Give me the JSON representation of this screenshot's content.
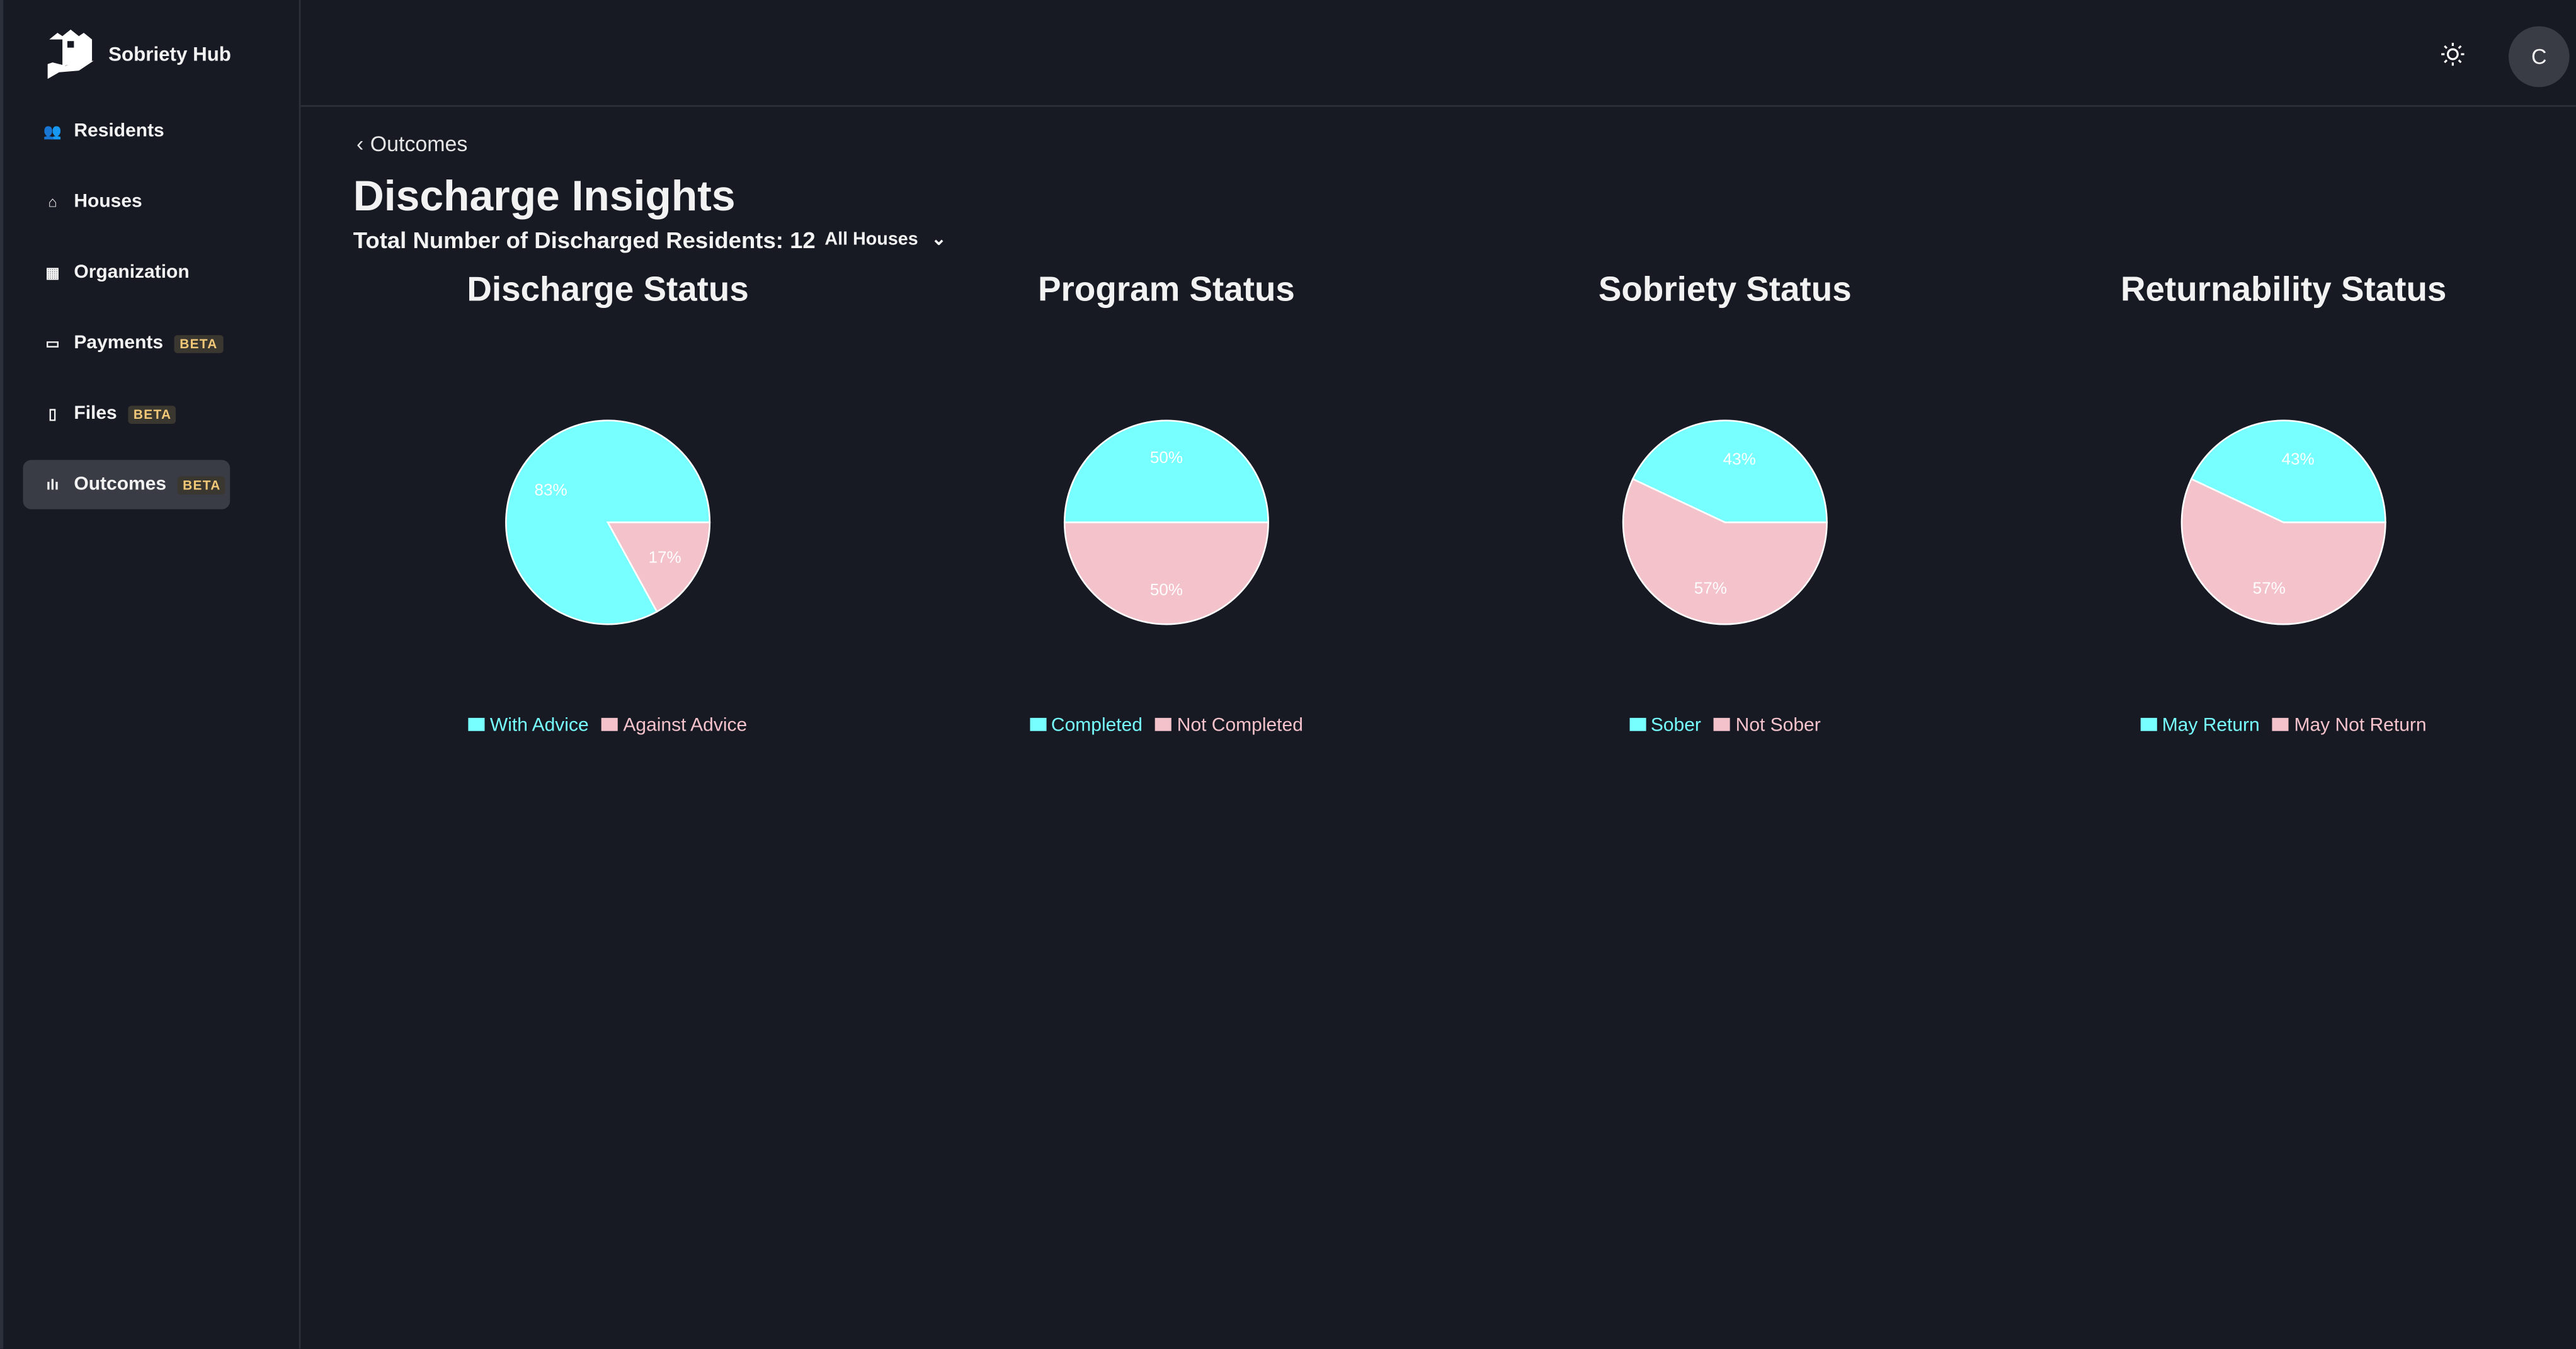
{
  "app": {
    "name": "Sobriety Hub"
  },
  "sidebar": {
    "items": [
      {
        "label": "Residents",
        "icon": "users-icon"
      },
      {
        "label": "Houses",
        "icon": "home-icon"
      },
      {
        "label": "Organization",
        "icon": "building-icon"
      },
      {
        "label": "Payments",
        "icon": "money-icon",
        "badge": "BETA"
      },
      {
        "label": "Files",
        "icon": "file-icon",
        "badge": "BETA"
      },
      {
        "label": "Outcomes",
        "icon": "bar-chart-icon",
        "badge": "BETA",
        "active": true
      }
    ]
  },
  "header": {
    "theme_icon": "sun-icon",
    "avatar": "C"
  },
  "page": {
    "back_label": "Outcomes",
    "title": "Discharge Insights",
    "total": "Total Number of Discharged Residents: 12",
    "filter": "All Houses"
  },
  "colors": {
    "primary": "#77ffff",
    "secondary": "#f4c2cb",
    "background": "#171a23"
  },
  "chart_data": [
    {
      "type": "pie",
      "title": "Discharge Status",
      "labels": [
        "With Advice",
        "Against Advice"
      ],
      "values": [
        83,
        17
      ]
    },
    {
      "type": "pie",
      "title": "Program Status",
      "labels": [
        "Completed",
        "Not Completed"
      ],
      "values": [
        50,
        50
      ]
    },
    {
      "type": "pie",
      "title": "Sobriety Status",
      "labels": [
        "Sober",
        "Not Sober"
      ],
      "values": [
        43,
        57
      ]
    },
    {
      "type": "pie",
      "title": "Returnability Status",
      "labels": [
        "May Return",
        "May Not Return"
      ],
      "values": [
        43,
        57
      ]
    }
  ]
}
